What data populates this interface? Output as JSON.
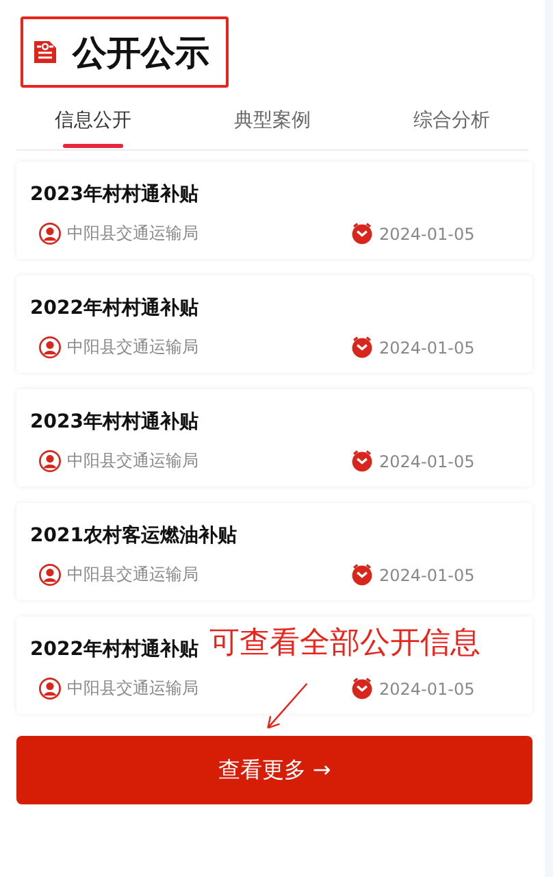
{
  "header": {
    "title": "公开公示"
  },
  "tabs": [
    {
      "label": "信息公开",
      "selected": true
    },
    {
      "label": "典型案例",
      "selected": false
    },
    {
      "label": "综合分析",
      "selected": false
    }
  ],
  "items": [
    {
      "title": "2023年村村通补贴",
      "department": "中阳县交通运输局",
      "date": "2024-01-05"
    },
    {
      "title": "2022年村村通补贴",
      "department": "中阳县交通运输局",
      "date": "2024-01-05"
    },
    {
      "title": "2023年村村通补贴",
      "department": "中阳县交通运输局",
      "date": "2024-01-05"
    },
    {
      "title": "2021农村客运燃油补贴",
      "department": "中阳县交通运输局",
      "date": "2024-01-05"
    },
    {
      "title": "2022年村村通补贴",
      "department": "中阳县交通运输局",
      "date": "2024-01-05"
    }
  ],
  "annotation": {
    "text": "可查看全部公开信息"
  },
  "more_button": {
    "label": "查看更多",
    "arrow": "→"
  }
}
